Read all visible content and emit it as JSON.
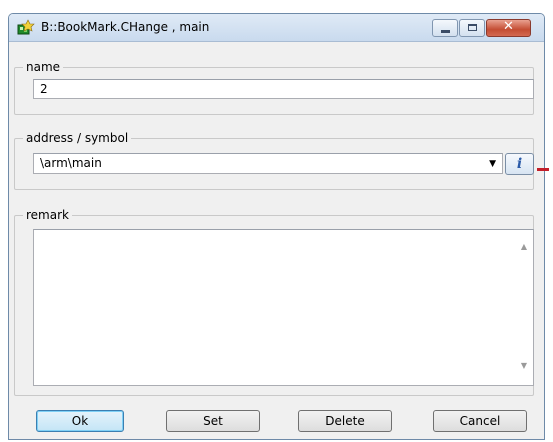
{
  "window": {
    "title": "B::BookMark.CHange , main",
    "icon": "trace32-app-icon",
    "controls": {
      "minimize": "minimize-icon",
      "maximize": "maximize-icon",
      "close": "close-icon",
      "close_glyph": "✕"
    }
  },
  "name_group": {
    "label": "name",
    "value": "2"
  },
  "address_group": {
    "label": "address / symbol",
    "value": "\\arm\\main",
    "dropdown_glyph": "▼",
    "info_button_glyph": "i"
  },
  "remark_group": {
    "label": "remark",
    "value": "",
    "scroll_up_glyph": "▲",
    "scroll_down_glyph": "▼"
  },
  "buttons": {
    "ok": "Ok",
    "set": "Set",
    "delete": "Delete",
    "cancel": "Cancel"
  },
  "colors": {
    "accent_mark": "#c31f2a",
    "close_button": "#c44d33",
    "default_button": "#c4e5f6"
  }
}
